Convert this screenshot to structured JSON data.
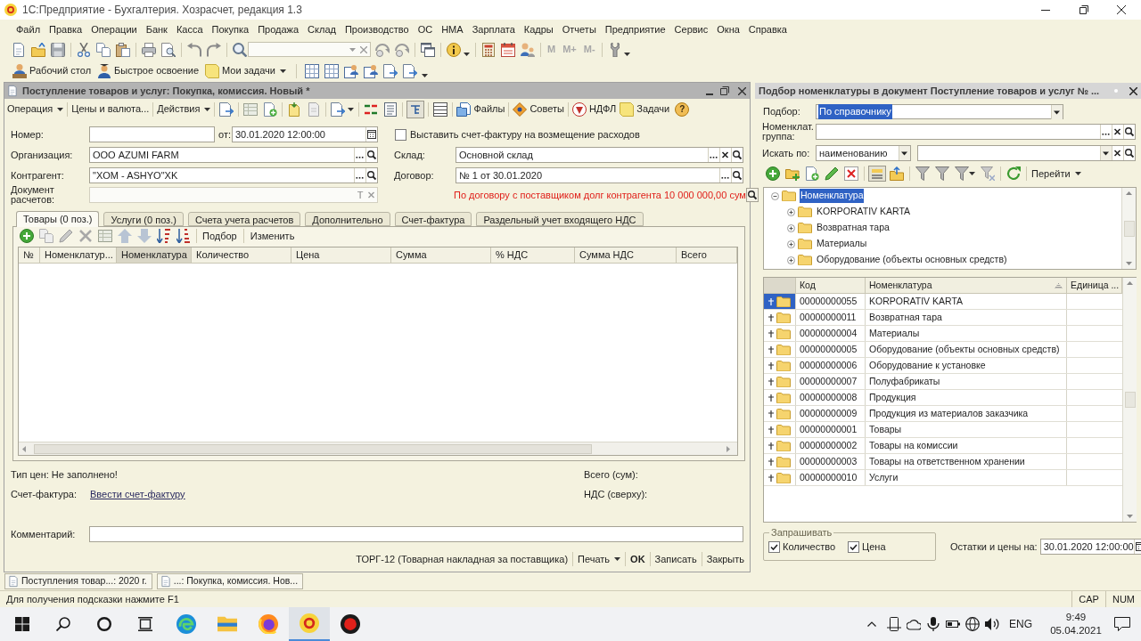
{
  "window": {
    "title": "1С:Предприятие - Бухгалтерия. Хозрасчет, редакция 1.3"
  },
  "menu": [
    "Файл",
    "Правка",
    "Операции",
    "Банк",
    "Касса",
    "Покупка",
    "Продажа",
    "Склад",
    "Производство",
    "ОС",
    "НМА",
    "Зарплата",
    "Кадры",
    "Отчеты",
    "Предприятие",
    "Сервис",
    "Окна",
    "Справка"
  ],
  "toolbar": {
    "memory_buttons": [
      "M",
      "M+",
      "M-"
    ]
  },
  "panel_bar": [
    {
      "label": "Рабочий стол",
      "kind": "button"
    },
    {
      "label": "Быстрое освоение",
      "kind": "button"
    },
    {
      "label": "Мои задачи",
      "kind": "menu"
    }
  ],
  "document": {
    "title": "Поступление товаров и услуг: Покупка, комиссия. Новый *",
    "toolbar": [
      {
        "label": "Операция",
        "kind": "menu"
      },
      {
        "label": "Цены и валюта...",
        "kind": "button"
      },
      {
        "label": "Действия",
        "kind": "menu"
      },
      {
        "label": "Файлы",
        "kind": "button"
      },
      {
        "label": "Советы",
        "kind": "button"
      },
      {
        "label": "НДФЛ",
        "kind": "button"
      },
      {
        "label": "Задачи",
        "kind": "button"
      }
    ],
    "help": "?",
    "number": {
      "label": "Номер:"
    },
    "date": {
      "label": "от:",
      "value": "30.01.2020 12:00:00"
    },
    "invoice_checkbox": {
      "label": "Выставить счет-фактуру на возмещение расходов",
      "checked": false
    },
    "organization": {
      "label": "Организация:",
      "value": "ООО AZUMI FARM"
    },
    "warehouse": {
      "label": "Склад:",
      "value": "Основной склад"
    },
    "counterparty": {
      "label": "Контрагент:",
      "value": "\"XOM - ASHYO\"XK"
    },
    "contract": {
      "label": "Договор:",
      "value": "№ 1 от 30.01.2020"
    },
    "settlement_document": {
      "label": "Документ расчетов:",
      "type_button": "T"
    },
    "debt_note": "По договору с поставщиком долг контрагента 10 000 000,00 сум",
    "tabs": [
      {
        "label": "Товары (0 поз.)",
        "selected": true
      },
      {
        "label": "Услуги (0 поз.)",
        "selected": false
      },
      {
        "label": "Счета учета расчетов",
        "selected": false
      },
      {
        "label": "Дополнительно",
        "selected": false
      },
      {
        "label": "Счет-фактура",
        "selected": false
      },
      {
        "label": "Раздельный учет входящего НДС",
        "selected": false
      }
    ],
    "table_toolbar": [
      "Подбор",
      "Изменить"
    ],
    "table": {
      "columns": [
        {
          "label": "№",
          "selected": false
        },
        {
          "label": "Номенклатур...",
          "selected": false
        },
        {
          "label": "Номенклатура",
          "selected": true
        },
        {
          "label": "Количество",
          "selected": false
        },
        {
          "label": "Цена",
          "selected": false
        },
        {
          "label": "Сумма",
          "selected": false
        },
        {
          "label": "% НДС",
          "selected": false
        },
        {
          "label": "Сумма НДС",
          "selected": false
        },
        {
          "label": "Всего",
          "selected": false
        }
      ]
    },
    "price_type": "Тип цен: Не заполнено!",
    "invoice": {
      "label": "Счет-фактура:",
      "link": "Ввести счет-фактуру"
    },
    "total": {
      "label": "Всего (сум):"
    },
    "vat": {
      "label": "НДС (сверху):"
    },
    "comment": {
      "label": "Комментарий:"
    },
    "footer": [
      {
        "label": "ТОРГ-12 (Товарная накладная за поставщика)",
        "kind": "button"
      },
      {
        "label": "Печать",
        "kind": "menu"
      },
      {
        "label": "OK",
        "kind": "default"
      },
      {
        "label": "Записать",
        "kind": "button"
      },
      {
        "label": "Закрыть",
        "kind": "button"
      }
    ]
  },
  "picker": {
    "title": "Подбор номенклатуры в документ Поступление товаров и услуг № ...",
    "selection": {
      "label": "Подбор:",
      "value": "По справочнику",
      "highlighted": true
    },
    "group": {
      "label": "Номенклат. группа:"
    },
    "search_by": {
      "label": "Искать по:",
      "value": "наименованию"
    },
    "toolbar": [
      {
        "label": "Перейти",
        "kind": "menu"
      }
    ],
    "tree": {
      "label": "Номенклатура",
      "selected": true,
      "expanded": true,
      "children": [
        {
          "label": "KORPORATIV KARTA",
          "selected": false,
          "expanded": false
        },
        {
          "label": "Возвратная тара",
          "selected": false,
          "expanded": false
        },
        {
          "label": "Материалы",
          "selected": false,
          "expanded": false
        },
        {
          "label": "Оборудование (объекты основных средств)",
          "selected": false,
          "expanded": false
        }
      ]
    },
    "table": {
      "columns": [
        {
          "label": "Код",
          "sorted": false
        },
        {
          "label": "Номенклатура",
          "sorted": true
        },
        {
          "label": "Единица ...",
          "sorted": false
        }
      ],
      "rows": [
        {
          "code": "00000000055",
          "name": "KORPORATIV KARTA",
          "selected": true
        },
        {
          "code": "00000000011",
          "name": "Возвратная тара",
          "selected": false
        },
        {
          "code": "00000000004",
          "name": "Материалы",
          "selected": false
        },
        {
          "code": "00000000005",
          "name": "Оборудование (объекты основных средств)",
          "selected": false
        },
        {
          "code": "00000000006",
          "name": "Оборудование к установке",
          "selected": false
        },
        {
          "code": "00000000007",
          "name": "Полуфабрикаты",
          "selected": false
        },
        {
          "code": "00000000008",
          "name": "Продукция",
          "selected": false
        },
        {
          "code": "00000000009",
          "name": "Продукция из материалов заказчика",
          "selected": false
        },
        {
          "code": "00000000001",
          "name": "Товары",
          "selected": false
        },
        {
          "code": "00000000002",
          "name": "Товары на комиссии",
          "selected": false
        },
        {
          "code": "00000000003",
          "name": "Товары на ответственном хранении",
          "selected": false
        },
        {
          "code": "00000000010",
          "name": "Услуги",
          "selected": false
        }
      ]
    },
    "ask": {
      "title": "Запрашивать",
      "options": [
        {
          "label": "Количество",
          "checked": true
        },
        {
          "label": "Цена",
          "checked": true
        }
      ]
    },
    "stock_date": {
      "label": "Остатки и цены на:",
      "value": "30.01.2020 12:00:00"
    }
  },
  "window_tabs": [
    "Поступления товар...: 2020 г.",
    "...: Покупка, комиссия. Нов..."
  ],
  "status_bar": {
    "hint": "Для получения подсказки нажмите F1",
    "indicators": [
      "CAP",
      "NUM"
    ]
  },
  "taskbar": {
    "language": "ENG",
    "time": "9:49",
    "date": "05.04.2021"
  }
}
